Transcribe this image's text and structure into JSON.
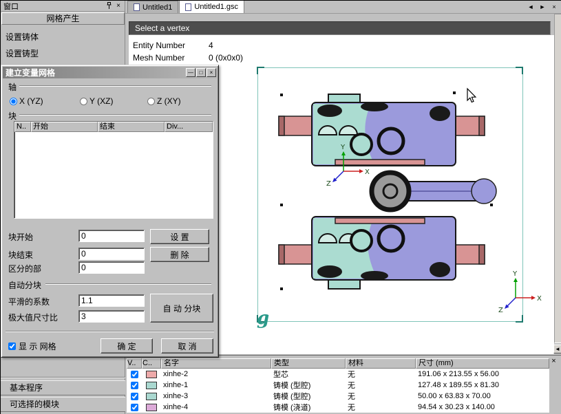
{
  "colors": {
    "window_gray": "#c0c0c0",
    "status_bar_bg": "#4d4d4d",
    "model_purple": "#9b9adc",
    "model_teal": "#abdcd1",
    "model_pink": "#d89494",
    "model_pink_dark": "#a86868",
    "model_dark": "#1a1a1a",
    "model_gray": "#9a9a9a",
    "selection": "#7fc4b8",
    "selection_corner": "#1e7a6e",
    "watermark_teal": "#2a9a8a",
    "axis_green": "#00a000",
    "axis_red": "#cc2020",
    "axis_blue": "#2222cc"
  },
  "left_panel": {
    "title": "窗口",
    "close": "×",
    "header": "网格产生",
    "items": [
      {
        "label": "设置铸体"
      },
      {
        "label": "设置铸型"
      }
    ],
    "sections": [
      {
        "label": "基本程序"
      },
      {
        "label": "可选择的模块"
      }
    ]
  },
  "dialog": {
    "title": "建立变量网格",
    "window_buttons": {
      "minimize": "—",
      "maximize": "□",
      "close": "×"
    },
    "axis": {
      "label": "轴",
      "options": [
        {
          "label": "X (YZ)",
          "selected": true
        },
        {
          "label": "Y (XZ)",
          "selected": false
        },
        {
          "label": "Z (XY)",
          "selected": false
        }
      ]
    },
    "block": {
      "label": "块",
      "columns": [
        "N..",
        "开始",
        "结束",
        "Div..."
      ]
    },
    "fields": {
      "block_start": {
        "label": "块开始",
        "value": "0"
      },
      "block_end": {
        "label": "块结束",
        "value": "0"
      },
      "partition": {
        "label": "区分的部",
        "value": "0"
      }
    },
    "auto": {
      "label": "自动分块",
      "smooth": {
        "label": "平滑的系数",
        "value": "1.1"
      },
      "max_ratio": {
        "label": "极大值尺寸比",
        "value": "3"
      }
    },
    "show_mesh": {
      "label": "显 示 网格",
      "checked": true
    },
    "buttons": {
      "set": "设 置",
      "remove": "删 除",
      "auto_divide": "自 动 分块",
      "ok": "确 定",
      "cancel": "取 消"
    }
  },
  "main": {
    "tabs": [
      {
        "label": "Untitled1",
        "active": false
      },
      {
        "label": "Untitled1.gsc",
        "active": true
      }
    ],
    "tab_nav": {
      "left": "◄",
      "right": "►",
      "close": "×"
    },
    "prompt": "Select a vertex",
    "info": [
      {
        "label": "Entity Number",
        "value": "4"
      },
      {
        "label": "Mesh Number",
        "value": "0 (0x0x0)"
      }
    ],
    "axes": {
      "x": "X",
      "y": "Y",
      "z": "Z"
    },
    "watermark": "g",
    "scroll_left": "◄"
  },
  "bottom_panel": {
    "close": "×",
    "columns": [
      "V..",
      "C..",
      "名字",
      "类型",
      "材料",
      "尺寸 (mm)"
    ],
    "rows": [
      {
        "checked": true,
        "color": "#eeaaaa",
        "name": "xinhe-2",
        "type": "型芯",
        "material": "无",
        "size": "191.06 x 213.55 x 56.00"
      },
      {
        "checked": true,
        "color": "#aad8d0",
        "name": "xinhe-1",
        "type": "铸模 (型腔)",
        "material": "无",
        "size": "127.48 x 189.55 x 81.30"
      },
      {
        "checked": true,
        "color": "#aad8d0",
        "name": "xinhe-3",
        "type": "铸模 (型腔)",
        "material": "无",
        "size": "50.00 x 63.83 x 70.00"
      },
      {
        "checked": true,
        "color": "#dcaad8",
        "name": "xinhe-4",
        "type": "铸模 (浇道)",
        "material": "无",
        "size": "94.54 x 30.23 x 140.00"
      }
    ]
  }
}
